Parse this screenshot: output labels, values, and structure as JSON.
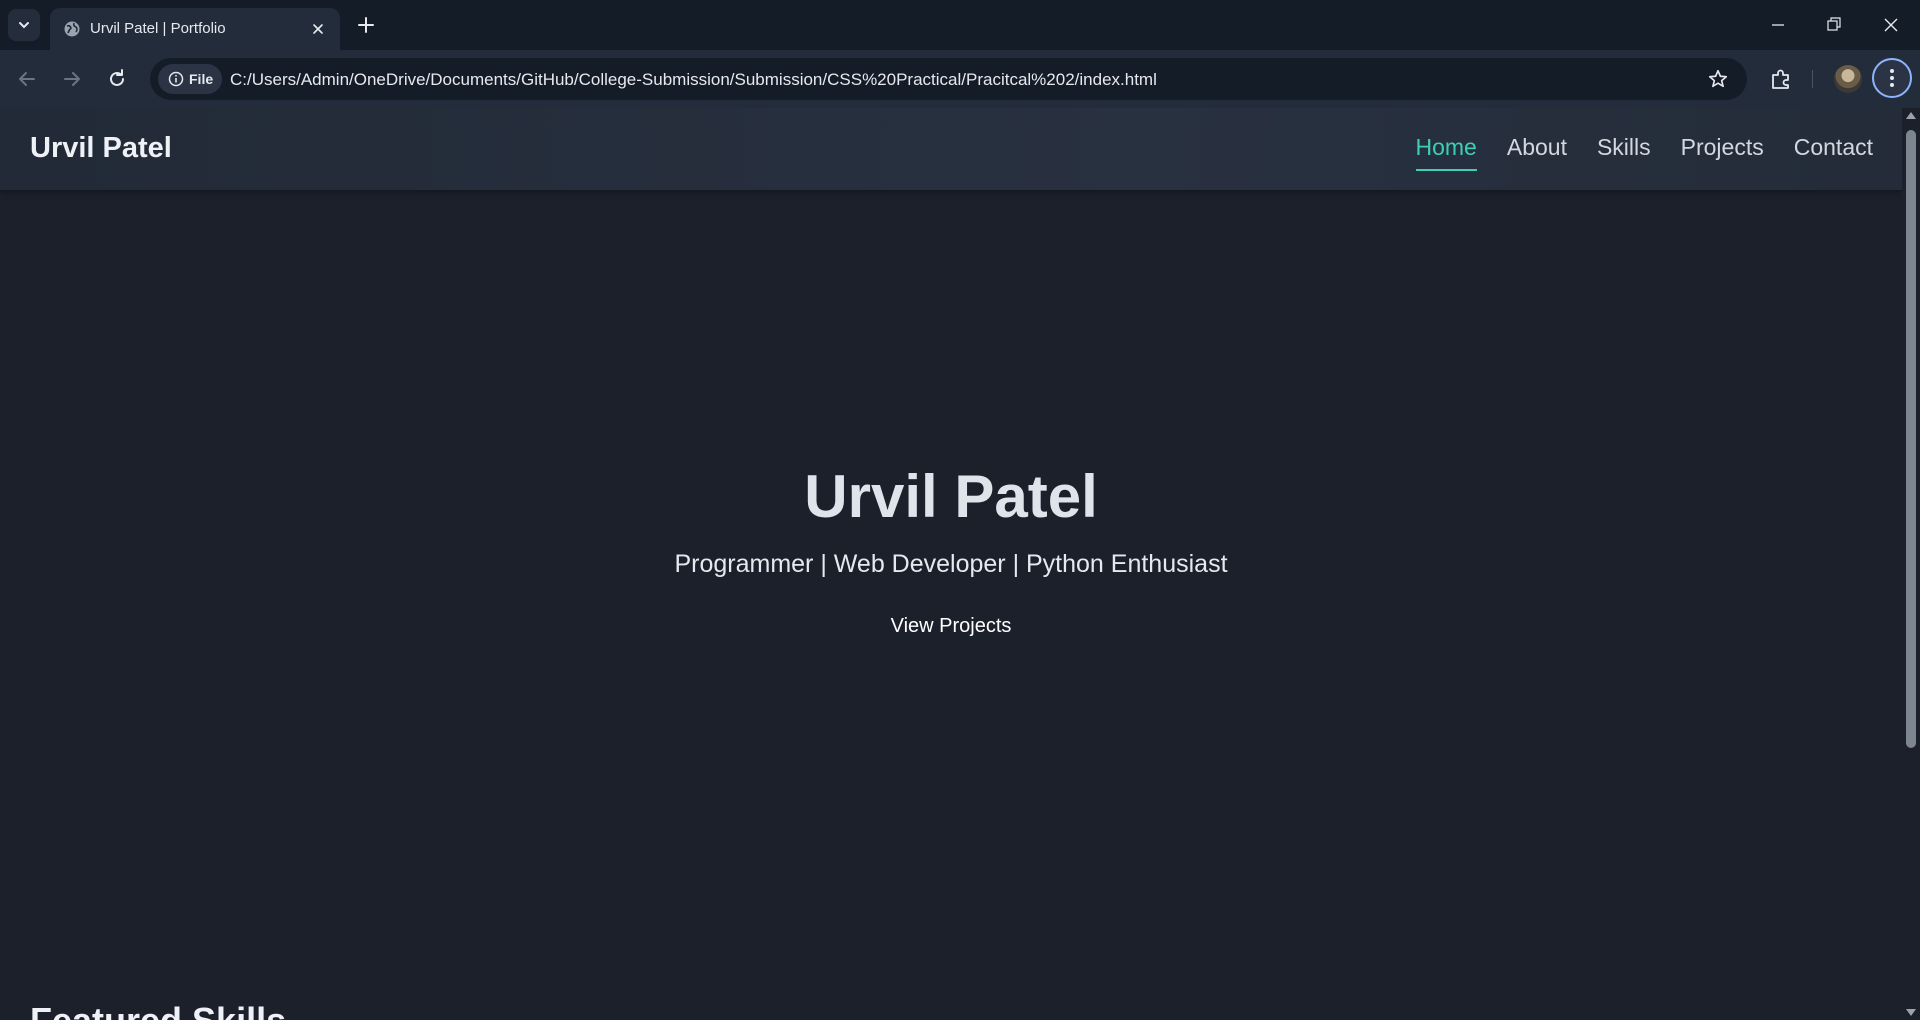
{
  "browser": {
    "tab": {
      "title": "Urvil Patel | Portfolio"
    },
    "address": {
      "chip_label": "File",
      "url": "C:/Users/Admin/OneDrive/Documents/GitHub/College-Submission/Submission/CSS%20Practical/Pracitcal%202/index.html"
    },
    "icons": {
      "tab_list": "chevron-down-icon",
      "favicon": "globe-icon",
      "close": "close-icon",
      "new_tab": "plus-icon",
      "back": "arrow-left-icon",
      "forward": "arrow-right-icon",
      "reload": "reload-icon",
      "info": "info-icon",
      "bookmark": "star-icon",
      "extensions": "puzzle-icon",
      "menu": "kebab-icon"
    }
  },
  "site": {
    "brand": "Urvil Patel",
    "nav": [
      {
        "label": "Home",
        "active": true
      },
      {
        "label": "About",
        "active": false
      },
      {
        "label": "Skills",
        "active": false
      },
      {
        "label": "Projects",
        "active": false
      },
      {
        "label": "Contact",
        "active": false
      }
    ],
    "hero": {
      "title": "Urvil Patel",
      "subtitle": "Programmer | Web Developer | Python Enthusiast",
      "button": "View Projects"
    },
    "next_section_heading": "Featured Skills"
  },
  "colors": {
    "background": "#1b202b",
    "accent": "#3ccfb4",
    "navbar": "#283140"
  }
}
